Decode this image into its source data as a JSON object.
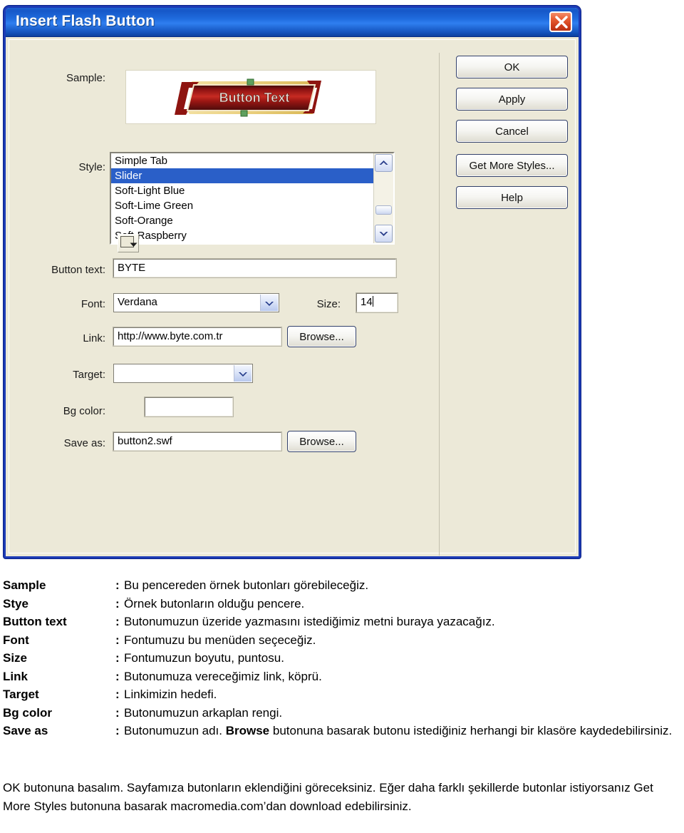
{
  "dialog": {
    "title": "Insert Flash Button",
    "close_icon": "close-icon",
    "labels": {
      "sample": "Sample:",
      "style": "Style:",
      "button_text": "Button text:",
      "font": "Font:",
      "size": "Size:",
      "link": "Link:",
      "target": "Target:",
      "bg_color": "Bg color:",
      "save_as": "Save as:"
    },
    "sample": {
      "button_caption": "Button Text"
    },
    "style_list": {
      "items": [
        {
          "label": "Simple Tab",
          "selected": false
        },
        {
          "label": "Slider",
          "selected": true
        },
        {
          "label": "Soft-Light Blue",
          "selected": false
        },
        {
          "label": "Soft-Lime Green",
          "selected": false
        },
        {
          "label": "Soft-Orange",
          "selected": false
        },
        {
          "label": "Soft-Raspberry",
          "selected": false
        }
      ],
      "scroll_up_icon": "chevron-up-icon",
      "scroll_down_icon": "chevron-down-icon"
    },
    "fields": {
      "button_text_value": "BYTE",
      "font_value": "Verdana",
      "size_value": "14",
      "link_value": "http://www.byte.com.tr",
      "target_value": "",
      "bg_color_value": "",
      "save_as_value": "button2.swf"
    },
    "buttons": {
      "link_browse": "Browse...",
      "save_browse": "Browse...",
      "ok": "OK",
      "apply": "Apply",
      "cancel": "Cancel",
      "get_more_styles": "Get More Styles...",
      "help": "Help"
    },
    "colors": {
      "titlebar_blue": "#1e62d0",
      "dialog_face": "#ece9d8",
      "selection_blue": "#2a5fc8",
      "close_red": "#d0401c",
      "sample_button_red": "#a81818"
    }
  },
  "legend": {
    "rows": [
      {
        "term": "Sample",
        "colon": ":",
        "desc": "Bu pencereden örnek butonları görebileceğiz."
      },
      {
        "term": "Stye",
        "colon": ":",
        "desc": "Örnek butonların olduğu pencere."
      },
      {
        "term": "Button text",
        "colon": ":",
        "desc": "Butonumuzun üzeride yazmasını istediğimiz metni buraya yazacağız."
      },
      {
        "term": "Font",
        "colon": ":",
        "desc": "Fontumuzu bu menüden seçeceğiz."
      },
      {
        "term": "Size",
        "colon": ":",
        "desc": "Fontumuzun boyutu, puntosu."
      },
      {
        "term": "Link",
        "colon": ":",
        "desc": "Butonumuza vereceğimiz link, köprü."
      },
      {
        "term": "Target",
        "colon": ":",
        "desc": "Linkimizin hedefi."
      },
      {
        "term": "Bg color",
        "colon": ":",
        "desc": "Butonumuzun arkaplan rengi."
      }
    ],
    "save_as_row": {
      "term": "Save as",
      "colon": ":",
      "desc_before": "Butonumuzun adı. ",
      "desc_bold": "Browse",
      "desc_after": " butonuna basarak butonu istediğiniz herhangi bir klasöre kaydedebilirsiniz."
    }
  },
  "paragraph": {
    "text": "OK butonuna basalım. Sayfamıza butonların eklendiğini göreceksiniz. Eğer daha farklı şekillerde butonlar istiyorsanız Get More Styles butonuna basarak macromedia.com’dan download edebilirsiniz."
  }
}
